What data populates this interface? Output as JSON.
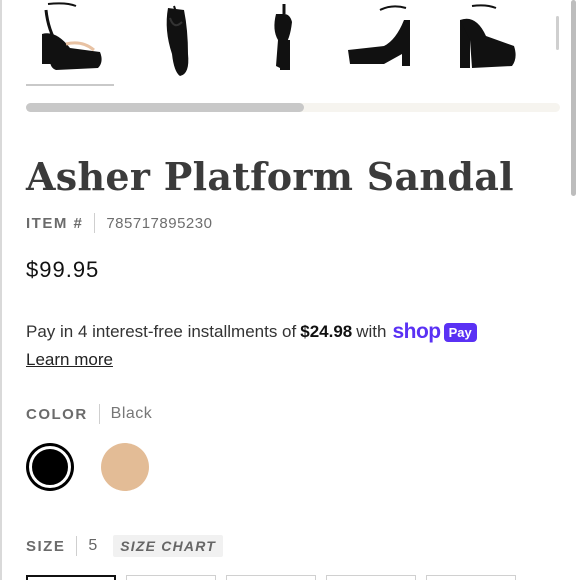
{
  "product": {
    "title": "Asher Platform Sandal",
    "item_label": "ITEM #",
    "item_number": "785717895230",
    "price": "$99.95"
  },
  "installments": {
    "prefix": "Pay in 4 interest-free installments of",
    "amount": "$24.98",
    "suffix": "with",
    "shop_logo": "shop",
    "pay_badge": "Pay",
    "learn_more": "Learn more"
  },
  "color": {
    "label": "COLOR",
    "selected": "Black",
    "swatches": [
      {
        "name": "Black",
        "hex": "#000000"
      },
      {
        "name": "Nude",
        "hex": "#e3bc96"
      }
    ]
  },
  "size": {
    "label": "SIZE",
    "selected": "5",
    "size_chart": "SIZE CHART"
  },
  "carousel": {
    "thumbnails": [
      "front-view",
      "side-view",
      "back-view",
      "profile-view",
      "angle-view"
    ],
    "scroll_fraction": 0.52
  },
  "colors": {
    "brand_shop": "#5a31f4",
    "text_dark": "#222222"
  }
}
